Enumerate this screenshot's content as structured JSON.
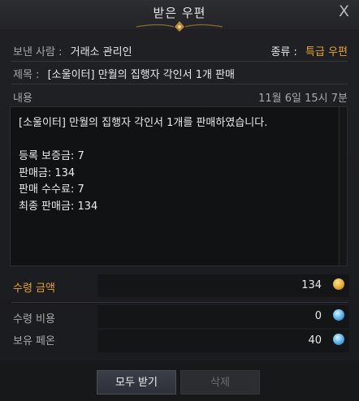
{
  "window": {
    "title": "받은 우편",
    "close_icon": "x"
  },
  "header": {
    "sender_label": "보낸 사람 :",
    "sender_value": "거래소 관리인",
    "type_label": "종류 :",
    "type_value": "특급 우편",
    "subject_label": "제목 :",
    "subject_value": "[소울이터] 만월의 집행자 각인서 1개 판매"
  },
  "content": {
    "label": "내용",
    "timestamp": "11월 6일 15시 7분",
    "lines": [
      "[소울이터] 만월의 집행자 각인서 1개를 판매하였습니다.",
      "",
      "등록 보증금: 7",
      "판매금: 134",
      "판매 수수료: 7",
      "최종 판매금: 134"
    ]
  },
  "amounts": {
    "receive_label": "수령 금액",
    "receive_value": "134",
    "receive_icon": "gold-coin-icon",
    "cost_label": "수령 비용",
    "cost_value": "0",
    "cost_icon": "phoenix-coin-icon",
    "owned_label": "보유 페온",
    "owned_value": "40",
    "owned_icon": "phoenix-coin-icon"
  },
  "buttons": {
    "receive_all": "모두 받기",
    "delete": "삭제"
  },
  "colors": {
    "accent_gold": "#e6a32a",
    "background": "#1b1c1f"
  }
}
